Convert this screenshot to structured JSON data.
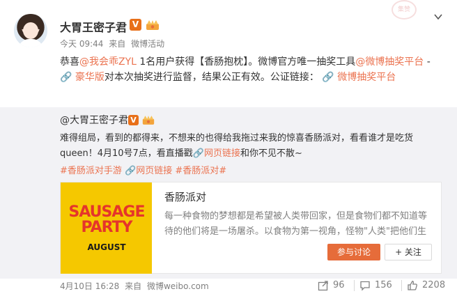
{
  "author": {
    "name": "大胃王密子君",
    "verified_mark": "V"
  },
  "stamp_text": "集赞",
  "meta": {
    "time": "今天 09:44",
    "from_label": "来自",
    "source": "微博活动"
  },
  "main_text": {
    "p1": "恭喜",
    "user_link": "@我会乖ZYL",
    "p2": " 1名用户获得【香肠抱枕】。微博官方唯一抽奖工具",
    "tool_link1": "@微博抽奖平台",
    "p3": " - ",
    "premium_link": "豪华版",
    "p4": "对本次抽奖进行监督，结果公正有效。公证链接：",
    "cert_link": "微博抽奖平台"
  },
  "retweet": {
    "author": "@大胃王密子君",
    "verified_mark": "V",
    "text1": "难得组局，看到的都得来，不想来的也得给我拖过来我的惊喜香肠派对，看看谁才是吃货queen！4月10号7点，看直播戳",
    "web_link": "网页链接",
    "text2": "和你不见不散~",
    "tags": {
      "topic_game": "#香肠派对手游",
      "web_link": "网页链接",
      "topic": "#香肠派对#"
    },
    "card": {
      "poster_line1": "SAUSAGE PARTY",
      "poster_line2": "AUGUST",
      "title": "香肠派对",
      "description": "每一种食物的梦想都是希望被人类带回家，但是食物们都不知道等待的他们将是一场屠杀。以食物为第一视角，怪物\"人类\"把他们生",
      "join_button": "参与讨论",
      "follow_button": "+ 关注"
    },
    "footer": {
      "time": "4月10日 16:28",
      "from_label": "来自",
      "source": "微博weibo.com",
      "reposts": "96",
      "comments": "156",
      "likes": "2208"
    }
  },
  "colors": {
    "link": "#eb7350",
    "verified": "#e8701a",
    "poster_bg": "#f5c800",
    "poster_text": "#e5352b",
    "retweet_bg": "#f2f2f5"
  },
  "icons": [
    "avatar",
    "verified-icon",
    "crown-icon",
    "chevron-down-icon",
    "link-icon",
    "repost-icon",
    "comment-icon",
    "like-icon"
  ]
}
